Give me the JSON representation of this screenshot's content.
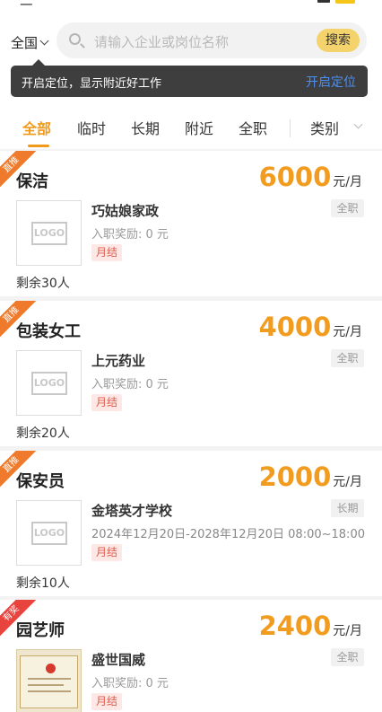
{
  "search": {
    "city": "全国",
    "placeholder": "请输入企业或岗位名称",
    "button": "搜索"
  },
  "location_tip": {
    "message": "开启定位，显示附近好工作",
    "action": "开启定位"
  },
  "tabs": [
    "全部",
    "临时",
    "长期",
    "附近",
    "全职"
  ],
  "category": "类别",
  "jobs": [
    {
      "tag": "直推",
      "title": "保洁",
      "salary": "6000",
      "unit": "元/月",
      "company": "巧姑娘家政",
      "bonus": "入职奖励: 0 元",
      "pay": "月结",
      "type": "全职",
      "remaining": "剩余30人",
      "logo": "LOGO"
    },
    {
      "tag": "直推",
      "title": "包装女工",
      "salary": "4000",
      "unit": "元/月",
      "company": "上元药业",
      "bonus": "入职奖励: 0 元",
      "pay": "月结",
      "type": "全职",
      "remaining": "剩余20人",
      "logo": "LOGO"
    },
    {
      "tag": "直推",
      "title": "保安员",
      "salary": "2000",
      "unit": "元/月",
      "company": "金塔英才学校",
      "period": "2024年12月20日-2028年12月20日 08:00~18:00",
      "pay": "月结",
      "type": "长期",
      "remaining": "剩余10人",
      "logo": "LOGO"
    },
    {
      "tag": "有奖",
      "title": "园艺师",
      "salary": "2400",
      "unit": "元/月",
      "company": "盛世国威",
      "bonus": "入职奖励: 0 元",
      "pay": "月结",
      "type": "全职"
    }
  ],
  "colors": {
    "accent": "#f19a1a",
    "search_button": "#f4d36c",
    "tip_link": "#4c8ff0",
    "pay_tag": "#e05a4b"
  }
}
